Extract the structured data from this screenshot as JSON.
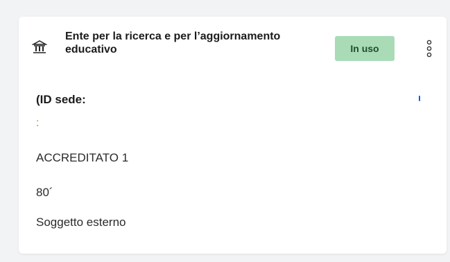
{
  "card": {
    "title": "Ente per la ricerca e per l’aggiornamento educativo",
    "status_badge": "In uso",
    "id_label": "(ID sede:",
    "id_value": ":",
    "accreditation": "ACCREDITATO 1",
    "code": "80´",
    "subject_type": "Soggetto esterno",
    "icons": {
      "institution": "institution-icon",
      "more": "more-vertical-icon"
    },
    "colors": {
      "badge_bg": "#a9dbb7",
      "badge_text": "#1d4f2b",
      "accent_blue": "#0b62d9"
    }
  }
}
